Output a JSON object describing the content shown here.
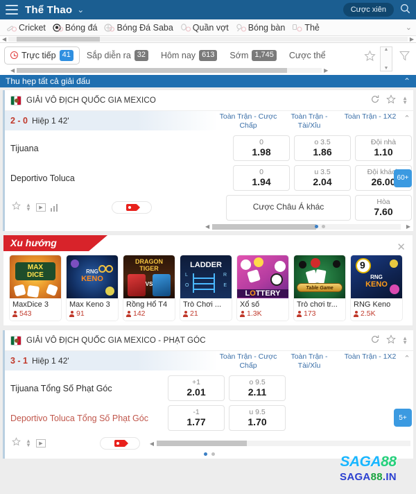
{
  "topbar": {
    "title": "Thể Thao",
    "parlay_label": "Cược xiên",
    "menu_icon": "hamburger-icon",
    "search_icon": "search-icon",
    "chevron": "⌄"
  },
  "sport_nav": {
    "items": [
      {
        "label": "Cricket",
        "icon": "cricket-icon"
      },
      {
        "label": "Bóng đá",
        "icon": "soccer-ball-icon"
      },
      {
        "label": "Bóng Đá Saba",
        "icon": "soccer-saba-icon"
      },
      {
        "label": "Quần vợt",
        "icon": "tennis-icon"
      },
      {
        "label": "Bóng bàn",
        "icon": "table-tennis-icon"
      },
      {
        "label": "Thẻ",
        "icon": "card-icon"
      }
    ],
    "more_chevron": "⌄"
  },
  "filter_tabs": {
    "tabs": [
      {
        "label": "Trực tiếp",
        "count": "41",
        "active": true,
        "count_style": "blue"
      },
      {
        "label": "Sắp diễn ra",
        "count": "32",
        "active": false,
        "count_style": "grey"
      },
      {
        "label": "Hôm nay",
        "count": "613",
        "active": false,
        "count_style": "grey"
      },
      {
        "label": "Sớm",
        "count": "1,745",
        "active": false,
        "count_style": "grey"
      },
      {
        "label": "Cược thể",
        "count": "",
        "active": false,
        "count_style": "none"
      }
    ],
    "favorite_icon": "star-icon",
    "filter_icon": "funnel-icon"
  },
  "collapse_bar": {
    "label": "Thu hẹp tất cả giải đấu",
    "chevron": "⌃"
  },
  "matches": [
    {
      "league": "GIẢI VÔ ĐỊCH QUỐC GIA MEXICO",
      "score": "2 - 0",
      "period": "Hiệp 1 42'",
      "market_headers": [
        "Toàn Trận - Cược Chấp",
        "Toàn Trận - Tài/Xỉu",
        "Toàn Trận - 1X2"
      ],
      "rows": [
        {
          "team": "Tijuana",
          "odds": [
            {
              "line": "0",
              "value": "1.98"
            },
            {
              "line": "o 3.5",
              "value": "1.86"
            },
            {
              "line": "Đội nhà",
              "value": "1.10"
            }
          ]
        },
        {
          "team": "Deportivo Toluca",
          "odds": [
            {
              "line": "0",
              "value": "1.94"
            },
            {
              "line": "u 3.5",
              "value": "2.04"
            },
            {
              "line": "Đội khách",
              "value": "26.00"
            }
          ]
        }
      ],
      "extra": {
        "more_label": "Cược Châu Á khác",
        "draw_line": "Hòa",
        "draw_value": "7.60"
      },
      "badge": "60+"
    },
    {
      "league": "GIẢI VÔ ĐỊCH QUỐC GIA MEXICO - PHẠT GÓC",
      "score": "3 - 1",
      "period": "Hiệp 1 42'",
      "market_headers": [
        "Toàn Trận - Cược Chấp",
        "Toàn Trận - Tài/Xỉu",
        "Toàn Trận - 1X2"
      ],
      "rows": [
        {
          "team": "Tijuana Tổng Số Phạt Góc",
          "odds": [
            {
              "line": "+1",
              "value": "2.01"
            },
            {
              "line": "o 9.5",
              "value": "2.11"
            }
          ]
        },
        {
          "team": "Deportivo Toluca Tổng Số Phạt Góc",
          "odds": [
            {
              "line": "-1",
              "value": "1.77"
            },
            {
              "line": "u 9.5",
              "value": "1.70"
            }
          ]
        }
      ],
      "badge": "5+"
    }
  ],
  "trending": {
    "ribbon": "Xu hướng",
    "close_icon": "close-icon",
    "games": [
      {
        "title": "MaxDice 3",
        "players": "543",
        "art": "maxdice"
      },
      {
        "title": "Max Keno 3",
        "players": "91",
        "art": "maxkeno"
      },
      {
        "title": "Rồng Hổ T4",
        "players": "142",
        "art": "dragontiger"
      },
      {
        "title": "Trò Chơi ...",
        "players": "21",
        "art": "ladder"
      },
      {
        "title": "Xổ số",
        "players": "1.3K",
        "art": "lottery"
      },
      {
        "title": "Trò chơi tr...",
        "players": "173",
        "art": "tablegame"
      },
      {
        "title": "RNG Keno",
        "players": "2.5K",
        "art": "rngkeno"
      }
    ]
  },
  "watermark": {
    "logo": "SAGA88",
    "url": "SAGA88.IN"
  },
  "colors": {
    "topbar": "#1b5e91",
    "accent_blue": "#2f8fe0",
    "ribbon_red": "#d8232a",
    "score_red": "#c0392b",
    "market_blue": "#3a6fa8"
  }
}
